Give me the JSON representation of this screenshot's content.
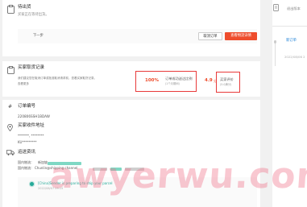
{
  "pending": {
    "title": "待出货",
    "subtitle": "买家正在等待出货。",
    "next_step": "下一步",
    "cancel_button": "取消订单",
    "ship_button": "查看物流详情"
  },
  "right_panel": {
    "top_text": "退出版本",
    "item_label": "新订单",
    "item_date": "2022/08/06 2"
  },
  "buyer_record": {
    "title": "买家取货记录",
    "description_line1": "我们建议您在取消订单或批准取消请求前，查看买家取货记录。",
    "description_line2": "查看更多",
    "rate_value": "100%",
    "rate_label": "订单成功送达比例",
    "rate_sub": "(1个月期间)",
    "score_value": "4.9",
    "score_unit": "分",
    "score_label": "买家评价",
    "score_sub": "(5.0满分)"
  },
  "order": {
    "number_label": "订单编号",
    "number_value": "220806SSH1BDAW",
    "address_label": "买家收件地址",
    "address_line1": "*******, ********",
    "address_line2": "KU*********",
    "logistics_label": "运送资讯",
    "shipping_method_label": "国内物流：",
    "shipping_method_value": "新加坡",
    "tracking_label": "国内物流：",
    "tracking_value": "Chunlin@shipping channel"
  },
  "timeline": {
    "event_text": "[China]Sender is preparing to ship your parcel",
    "event_time": "2022/08/07 09:15"
  },
  "watermark": "awyerwu.com",
  "colors": {
    "accent": "#ee4d2d",
    "highlight": "#e83a3a",
    "event_green": "#26aa99",
    "background": "#f1f1f1"
  }
}
